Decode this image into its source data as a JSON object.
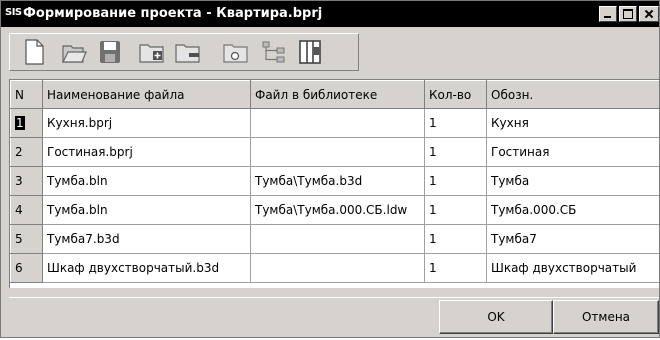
{
  "window": {
    "app_icon": "SIS",
    "title": "Формирование проекта - Квартира.bprj"
  },
  "toolbar": {
    "icons": [
      "new-file-icon",
      "open-folder-icon",
      "save-icon",
      "folder-add-icon",
      "folder-remove-icon",
      "folder-properties-icon",
      "tree-icon",
      "columns-icon"
    ]
  },
  "table": {
    "columns": [
      "N",
      "Наименование файла",
      "Файл в библиотеке",
      "Кол-во",
      "Обозн."
    ],
    "rows": [
      {
        "n": "1",
        "name": "Кухня.bprj",
        "lib": "",
        "qty": "1",
        "desig": "Кухня"
      },
      {
        "n": "2",
        "name": "Гостиная.bprj",
        "lib": "",
        "qty": "1",
        "desig": "Гостиная"
      },
      {
        "n": "3",
        "name": "Тумба.bln",
        "lib": "Тумба\\Тумба.b3d",
        "qty": "1",
        "desig": "Тумба"
      },
      {
        "n": "4",
        "name": "Тумба.bln",
        "lib": "Тумба\\Тумба.000.СБ.ldw",
        "qty": "1",
        "desig": "Тумба.000.СБ"
      },
      {
        "n": "5",
        "name": "Тумба7.b3d",
        "lib": "",
        "qty": "1",
        "desig": "Тумба7"
      },
      {
        "n": "6",
        "name": "Шкаф двухстворчатый.b3d",
        "lib": "",
        "qty": "1",
        "desig": "Шкаф двухстворчатый"
      }
    ]
  },
  "buttons": {
    "ok": "OK",
    "cancel": "Отмена"
  }
}
